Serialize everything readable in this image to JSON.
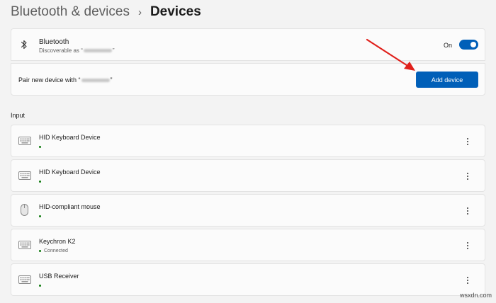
{
  "breadcrumb": {
    "parent": "Bluetooth & devices",
    "separator": "›",
    "current": "Devices"
  },
  "bluetooth": {
    "title": "Bluetooth",
    "subtitle_prefix": "Discoverable as “",
    "subtitle_suffix": "”",
    "toggle_label": "On",
    "toggle_state": true,
    "icon": "bluetooth-icon"
  },
  "pair": {
    "text_prefix": "Pair new device with “",
    "text_suffix": "”",
    "button_label": "Add device"
  },
  "input_section": {
    "label": "Input",
    "devices": [
      {
        "name": "HID Keyboard Device",
        "status": "",
        "icon": "keyboard-icon"
      },
      {
        "name": "HID Keyboard Device",
        "status": "",
        "icon": "keyboard-icon"
      },
      {
        "name": "HID-compliant mouse",
        "status": "",
        "icon": "mouse-icon"
      },
      {
        "name": "Keychron K2",
        "status": "Connected",
        "icon": "keyboard-icon"
      },
      {
        "name": "USB Receiver",
        "status": "",
        "icon": "keyboard-icon"
      }
    ]
  },
  "colors": {
    "accent": "#005fb8",
    "status_dot": "#0f7b0f",
    "arrow": "#e0201b",
    "background": "#f3f3f3"
  },
  "watermark": "wsxdn.com"
}
